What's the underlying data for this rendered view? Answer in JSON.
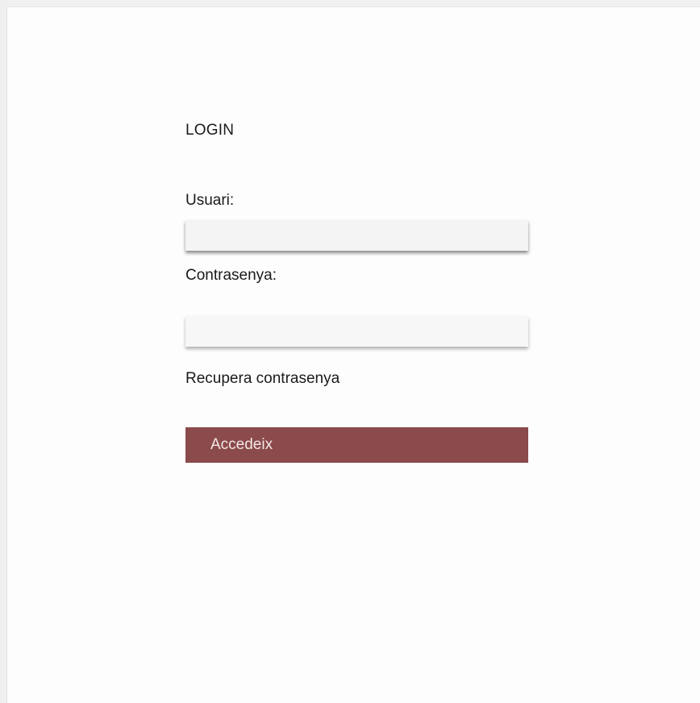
{
  "login": {
    "title": "LOGIN",
    "username_label": "Usuari:",
    "username_value": "",
    "password_label": "Contrasenya:",
    "password_value": "",
    "recover_link": "Recupera contrasenya",
    "submit_label": "Accedeix"
  },
  "colors": {
    "button_bg": "#8b4a4b",
    "button_text": "#f4e6e6",
    "page_bg": "#fdfdfd",
    "input_bg": "#f4f4f4"
  }
}
